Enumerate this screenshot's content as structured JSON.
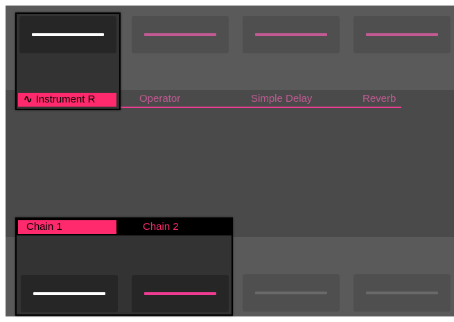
{
  "devices": {
    "selected": {
      "icon": "wave-icon",
      "label": "Instrument R"
    },
    "others": [
      {
        "label": "Operator"
      },
      {
        "label": "Simple Delay"
      },
      {
        "label": "Reverb"
      }
    ]
  },
  "chains": {
    "tabs": [
      {
        "label": "Chain 1",
        "selected": true
      },
      {
        "label": "Chain 2",
        "selected": false
      }
    ]
  },
  "colors": {
    "accent": "#ff2a6d",
    "accent_dim": "#c35a94",
    "background": "#5a5a5a",
    "band": "#4a4a4a",
    "highlight_box": "#333333"
  }
}
